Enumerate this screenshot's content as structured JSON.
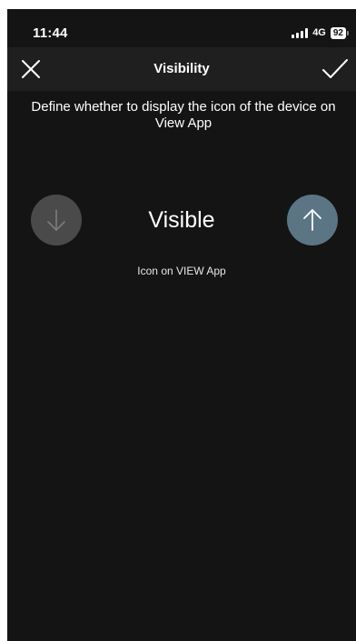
{
  "status_bar": {
    "time": "11:44",
    "network": "4G",
    "battery": "92"
  },
  "nav": {
    "title": "Visibility",
    "close_icon": "close-icon",
    "confirm_icon": "checkmark-icon"
  },
  "content": {
    "description": "Define whether to display the icon of the device on View App",
    "state_label": "Visible",
    "state_sublabel": "Icon on VIEW App",
    "down_icon": "arrow-down-icon",
    "up_icon": "arrow-up-icon"
  },
  "colors": {
    "background": "#141414",
    "nav_background": "#1f1f1f",
    "active_button": "#5b7585",
    "inactive_button": "#4a4a4a"
  }
}
